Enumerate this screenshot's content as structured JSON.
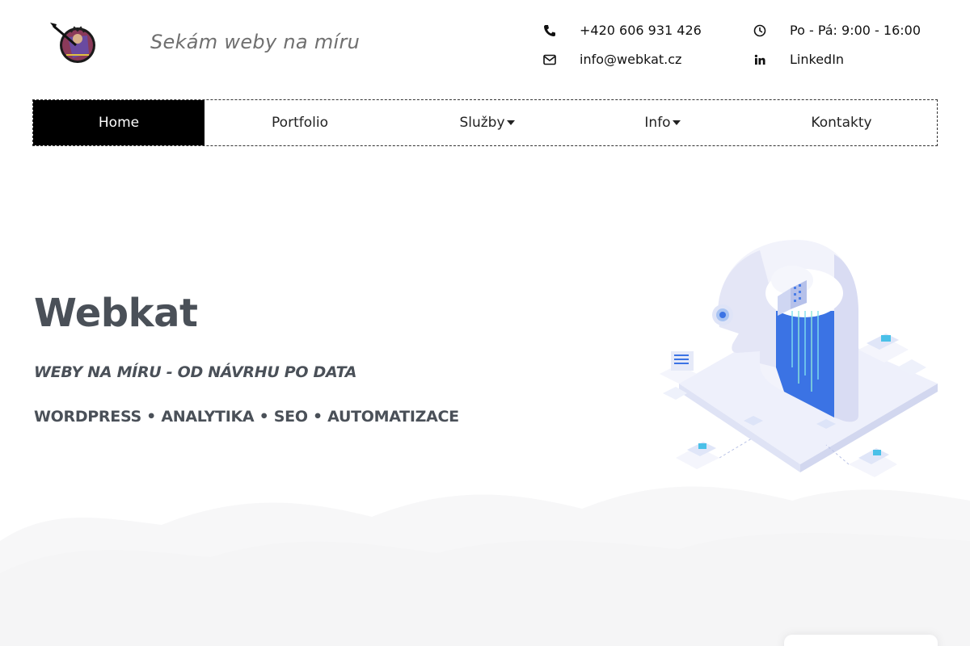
{
  "header": {
    "tagline": "Sekám weby na míru",
    "contacts": {
      "phone": {
        "icon": "phone-icon",
        "text": "+420 606 931 426"
      },
      "email": {
        "icon": "envelope-icon",
        "text": "info@webkat.cz"
      },
      "hours": {
        "icon": "clock-icon",
        "text": "Po - Pá: 9:00 - 16:00"
      },
      "linkedin": {
        "icon": "linkedin-icon",
        "text": "LinkedIn"
      }
    }
  },
  "nav": {
    "items": [
      {
        "label": "Home",
        "active": true,
        "dropdown": false
      },
      {
        "label": "Portfolio",
        "active": false,
        "dropdown": false
      },
      {
        "label": "Služby",
        "active": false,
        "dropdown": true
      },
      {
        "label": "Info",
        "active": false,
        "dropdown": true
      },
      {
        "label": "Kontakty",
        "active": false,
        "dropdown": false
      }
    ]
  },
  "hero": {
    "title": "Webkat",
    "subtitle": "WEBY NA MÍRU - OD NÁVRHU PO DATA",
    "tags": "WORDPRESS • ANALYTIKA • SEO • AUTOMATIZACE"
  },
  "colors": {
    "heading": "#4a5058",
    "tagline": "#6f6f6f",
    "nav_active_bg": "#000000",
    "accent_blue": "#2f6fe0"
  }
}
